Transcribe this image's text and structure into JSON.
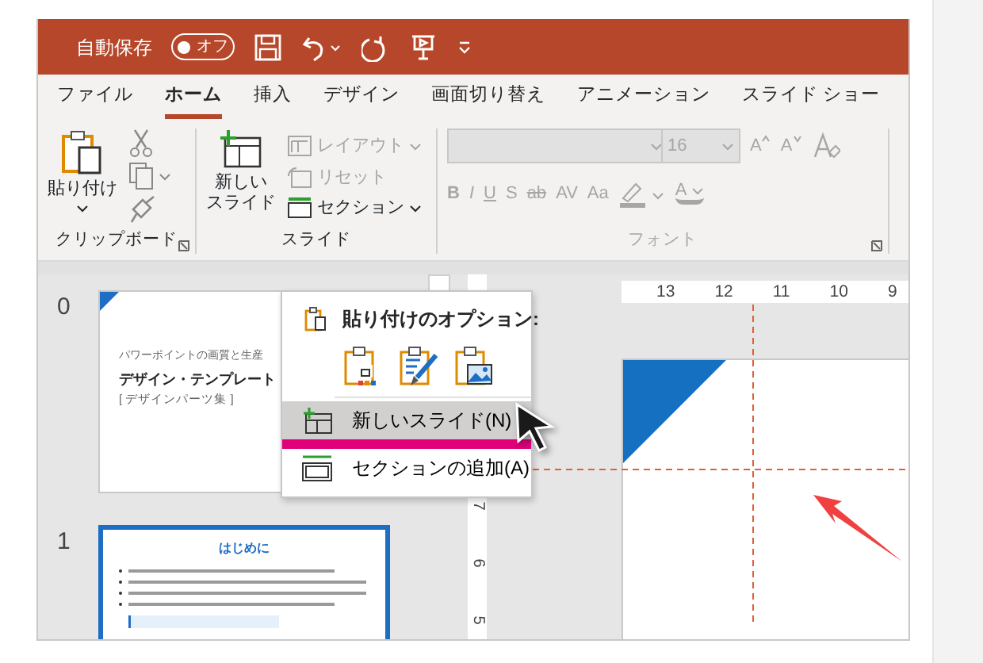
{
  "title_bar": {
    "autosave_label": "自動保存",
    "autosave_toggle": {
      "label": "オフ",
      "on": false
    }
  },
  "tabs": [
    {
      "label": "ファイル",
      "selected": false
    },
    {
      "label": "ホーム",
      "selected": true
    },
    {
      "label": "挿入",
      "selected": false
    },
    {
      "label": "デザイン",
      "selected": false
    },
    {
      "label": "画面切り替え",
      "selected": false
    },
    {
      "label": "アニメーション",
      "selected": false
    },
    {
      "label": "スライド ショー",
      "selected": false
    }
  ],
  "ribbon": {
    "clipboard": {
      "paste_label": "貼り付け",
      "group_label": "クリップボード"
    },
    "slides": {
      "new_slide_label": [
        "新しい",
        "スライド"
      ],
      "layout_label": "レイアウト",
      "layout_disabled": true,
      "reset_label": "リセット",
      "reset_disabled": true,
      "section_label": "セクション",
      "group_label": "スライド"
    },
    "font": {
      "disabled": true,
      "font_size": "16",
      "grow_label": "A",
      "shrink_label": "A",
      "format_buttons": [
        "B",
        "I",
        "U",
        "S",
        "ab",
        "AV",
        "Aa"
      ],
      "color_label": "A",
      "group_label": "フォント"
    }
  },
  "thumbnails": [
    {
      "number": "0",
      "selected": false,
      "kind": "title",
      "subtitle": "パワーポイントの画質と生産",
      "title": "デザイン・テンプレート",
      "tag": "[ デザインパーツ集 ]"
    },
    {
      "number": "1",
      "selected": true,
      "kind": "content",
      "title": "はじめに"
    }
  ],
  "h_ruler": [
    "13",
    "12",
    "11",
    "10",
    "9"
  ],
  "v_ruler": [
    "7",
    "6",
    "5"
  ],
  "context_menu": {
    "header": "貼り付けのオプション:",
    "items": [
      {
        "label": "新しいスライド(N)",
        "selected": true,
        "kind": "new-slide"
      },
      {
        "label": "セクションの追加(A)",
        "selected": false,
        "kind": "section"
      }
    ]
  }
}
